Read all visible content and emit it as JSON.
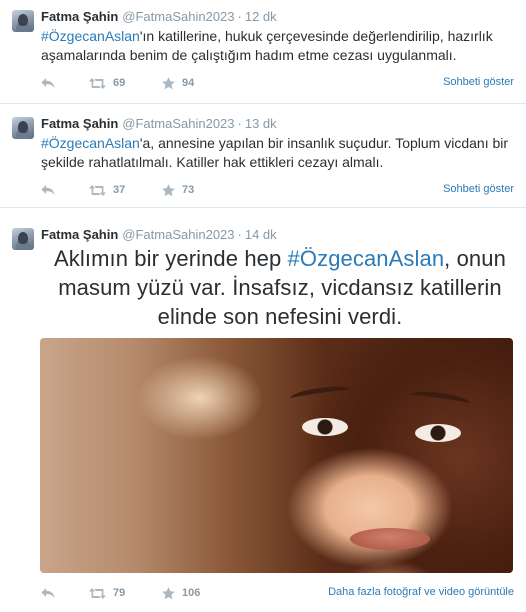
{
  "tweets": [
    {
      "name": "Fatma Şahin",
      "handle": "@FatmaSahin2023",
      "dot": "·",
      "time": "12 dk",
      "hashtag": "#ÖzgecanAslan",
      "text": "'ın katillerine, hukuk çerçevesinde değerlendirilip, hazırlık aşamalarında benim de çalıştığım hadım etme cezası uygulanmalı.",
      "retweets": "69",
      "favorites": "94",
      "more_link": "Sohbeti göster"
    },
    {
      "name": "Fatma Şahin",
      "handle": "@FatmaSahin2023",
      "dot": "·",
      "time": "13 dk",
      "hashtag": "#ÖzgecanAslan",
      "text": "'a, annesine yapılan bir insanlık suçudur. Toplum vicdanı bir şekilde rahatlatılmalı. Katiller hak ettikleri cezayı almalı.",
      "retweets": "37",
      "favorites": "73",
      "more_link": "Sohbeti göster"
    },
    {
      "name": "Fatma Şahin",
      "handle": "@FatmaSahin2023",
      "dot": "·",
      "time": "14 dk",
      "text_before": "Aklımın bir yerinde hep ",
      "hashtag": "#ÖzgecanAslan",
      "text_after": ", onun masum yüzü var. İnsafsız, vicdansız katillerin elinde son nefesini verdi.",
      "retweets": "79",
      "favorites": "106",
      "more_link": "Daha fazla fotoğraf ve video görüntüle"
    }
  ],
  "icons": {
    "reply": "reply-icon",
    "retweet": "retweet-icon",
    "favorite": "star-icon"
  },
  "colors": {
    "link": "#2b7bb9",
    "muted": "#8899a6",
    "text": "#292f33"
  }
}
